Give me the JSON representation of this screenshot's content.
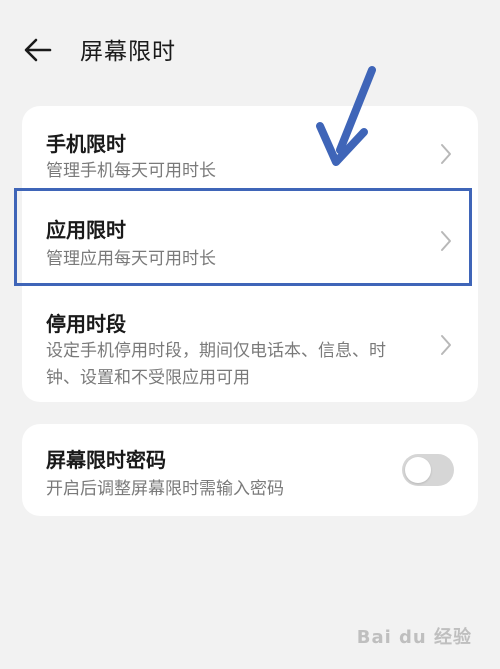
{
  "header": {
    "title": "屏幕限时"
  },
  "settings": {
    "items": [
      {
        "title": "手机限时",
        "subtitle": "管理手机每天可用时长"
      },
      {
        "title": "应用限时",
        "subtitle": "管理应用每天可用时长"
      },
      {
        "title": "停用时段",
        "subtitle": "设定手机停用时段，期间仅电话本、信息、时钟、设置和不受限应用可用"
      }
    ],
    "password": {
      "title": "屏幕限时密码",
      "subtitle": "开启后调整屏幕限时需输入密码",
      "enabled": false
    }
  },
  "annotation": {
    "color": "#3f65b8"
  },
  "watermark": {
    "text": "Bai du 经验"
  },
  "icons": {
    "back": "back-arrow-icon",
    "chevron": "chevron-right-icon",
    "annotation_arrow": "pointer-arrow-icon"
  }
}
